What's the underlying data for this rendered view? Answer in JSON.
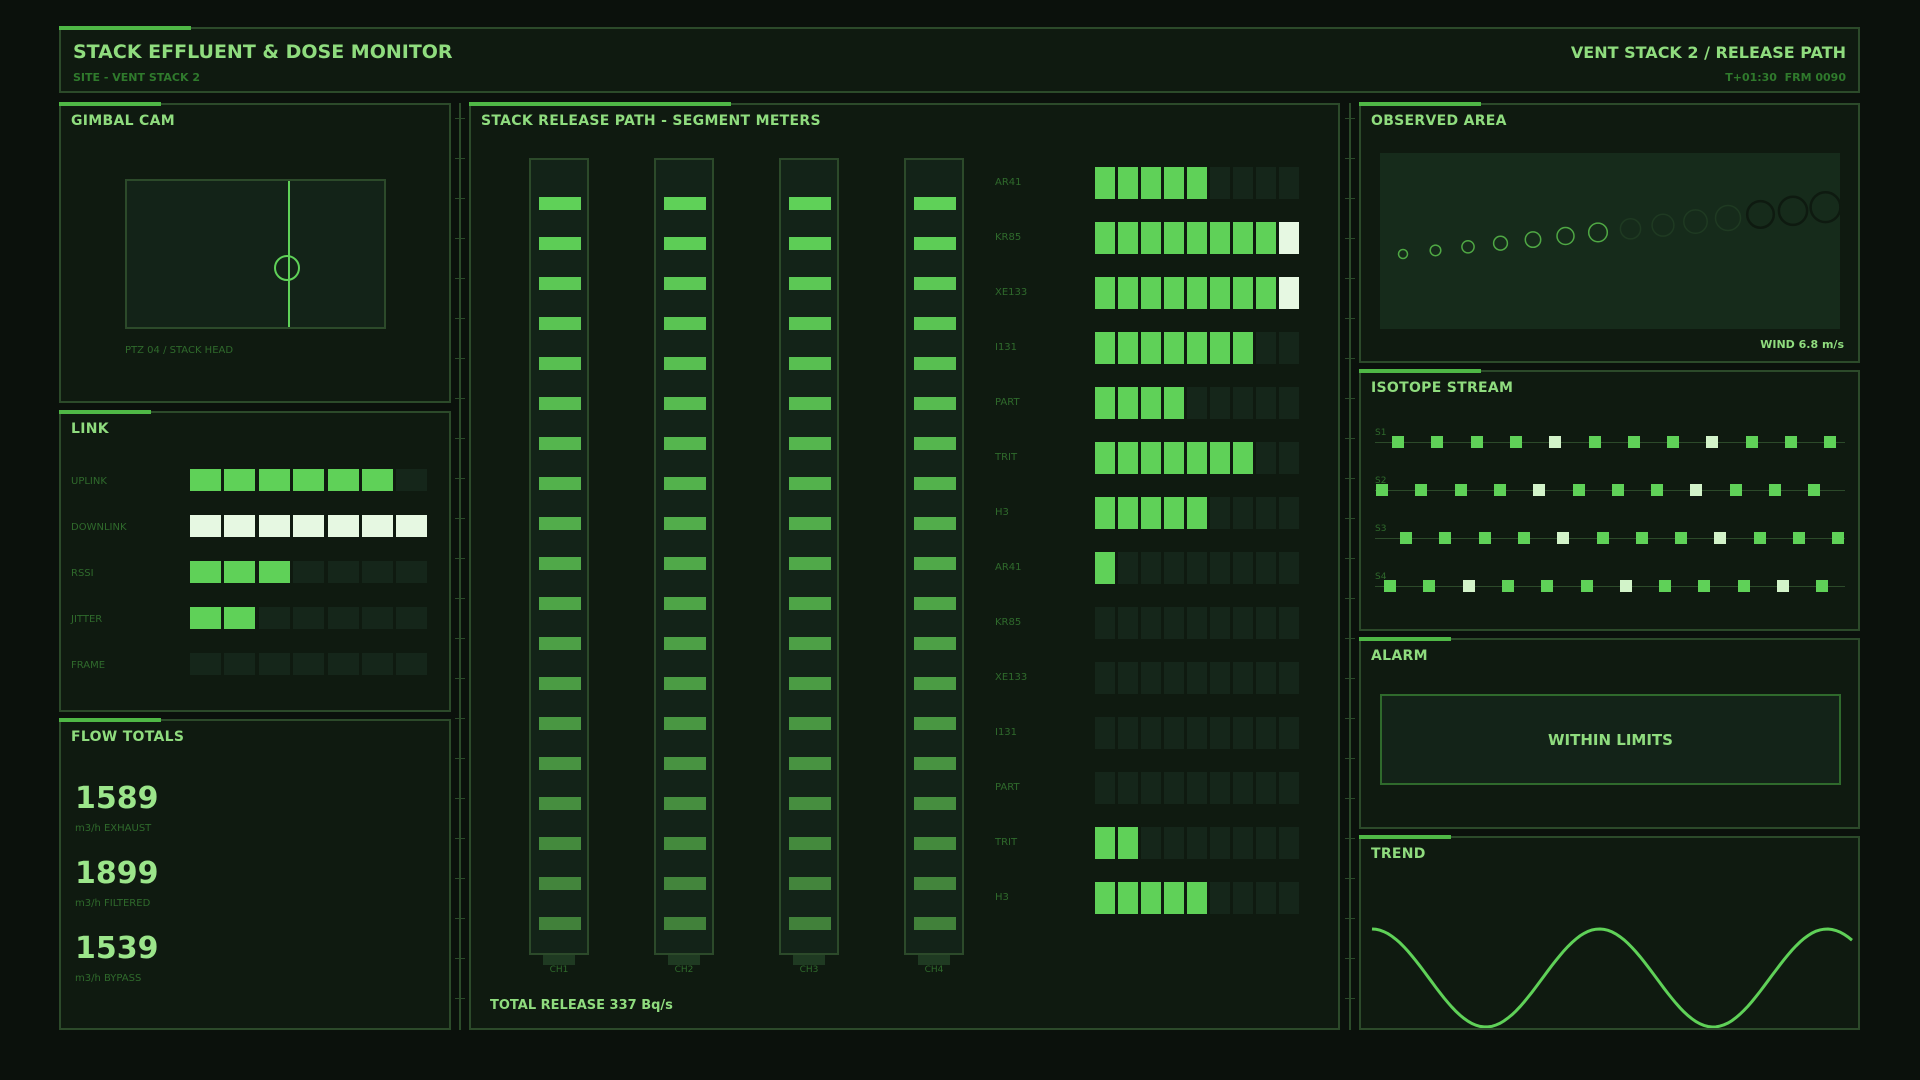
{
  "header": {
    "title": "STACK EFFLUENT & DOSE MONITOR",
    "subtitle": "SITE - VENT STACK 2",
    "right_title": "VENT STACK 2 / RELEASE PATH",
    "right_status": "T+01:30  FRM 0090"
  },
  "gimbal": {
    "title": "GIMBAL CAM",
    "caption": "PTZ 04 / STACK HEAD"
  },
  "link": {
    "title": "LINK",
    "rows": [
      {
        "label": "UPLINK",
        "lit": 6,
        "white": false
      },
      {
        "label": "DOWNLINK",
        "lit": 7,
        "white": true
      },
      {
        "label": "RSSI",
        "lit": 3,
        "white": false
      },
      {
        "label": "JITTER",
        "lit": 2,
        "white": false
      },
      {
        "label": "FRAME",
        "lit": 0,
        "white": false
      }
    ]
  },
  "flow": {
    "title": "FLOW TOTALS",
    "items": [
      {
        "value": "1589",
        "unit": "m3/h EXHAUST"
      },
      {
        "value": "1899",
        "unit": "m3/h FILTERED"
      },
      {
        "value": "1539",
        "unit": "m3/h BYPASS"
      }
    ]
  },
  "release": {
    "title": "STACK RELEASE PATH - SEGMENT METERS",
    "channels": [
      "CH1",
      "CH2",
      "CH3",
      "CH4"
    ],
    "total": "TOTAL RELEASE 337 Bq/s",
    "meters": [
      {
        "label": "AR41",
        "lit": 5
      },
      {
        "label": "KR85",
        "lit": 9
      },
      {
        "label": "XE133",
        "lit": 9
      },
      {
        "label": "I131",
        "lit": 7
      },
      {
        "label": "PART",
        "lit": 4
      },
      {
        "label": "TRIT",
        "lit": 7
      },
      {
        "label": "H3",
        "lit": 5
      },
      {
        "label": "AR41",
        "lit": 1
      },
      {
        "label": "KR85",
        "lit": 0
      },
      {
        "label": "XE133",
        "lit": 0
      },
      {
        "label": "I131",
        "lit": 0
      },
      {
        "label": "PART",
        "lit": 0
      },
      {
        "label": "TRIT",
        "lit": 2
      },
      {
        "label": "H3",
        "lit": 5
      }
    ]
  },
  "observed": {
    "title": "OBSERVED AREA",
    "wind": "WIND 6.8 m/s"
  },
  "isotope": {
    "title": "ISOTOPE STREAM",
    "streams": [
      "S1",
      "S2",
      "S3",
      "S4"
    ]
  },
  "alarm": {
    "title": "ALARM",
    "status": "WITHIN LIMITS"
  },
  "trend": {
    "title": "TREND"
  },
  "colors": {
    "lit": "#5fd158",
    "white": "#e6f8e2",
    "dim": "#15261a",
    "border": "#2c4a2a"
  }
}
